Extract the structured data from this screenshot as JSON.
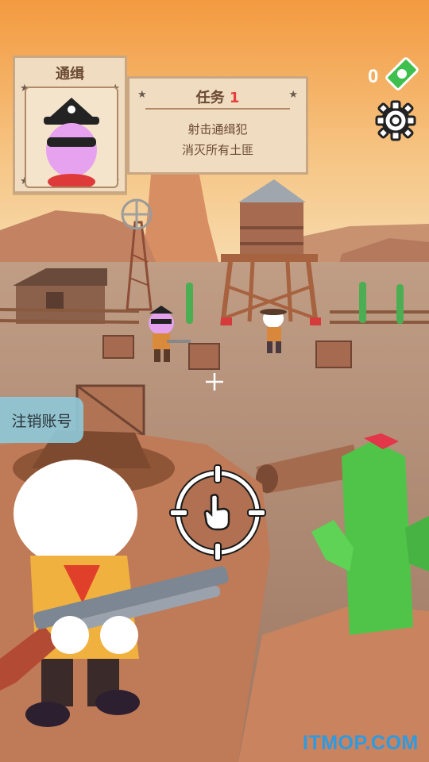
{
  "poster": {
    "title": "通缉"
  },
  "mission": {
    "title": "任务",
    "number": "1",
    "lines": [
      "射击通缉犯",
      "消灭所有土匪"
    ]
  },
  "currency": {
    "count": "0",
    "icon": "cash-icon"
  },
  "settings": {
    "icon": "gear-icon"
  },
  "account": {
    "logout_label": "注销账号"
  },
  "crosshair": {
    "icon": "hand-pointer-icon"
  },
  "watermark": "ITMOP.COM",
  "colors": {
    "sky_top": "#f6a24a",
    "sky_bottom": "#f7d9a4",
    "ground": "#b58f74",
    "card_bg": "#f0dcc0",
    "card_border": "#caa783",
    "accent_red": "#e5403d",
    "cactus_green": "#4fc449",
    "watermark_blue": "#2e9ae0"
  }
}
